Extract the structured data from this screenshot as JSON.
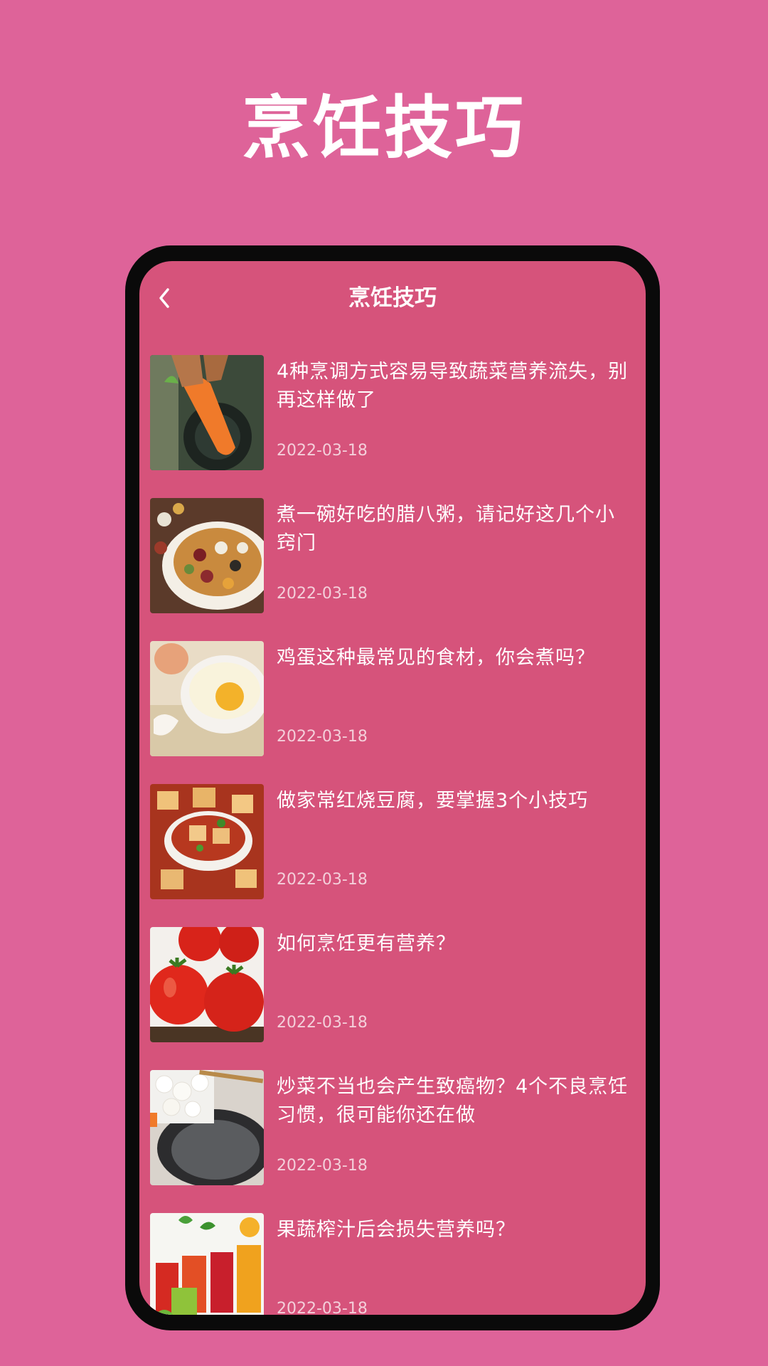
{
  "promo": {
    "title": "烹饪技巧"
  },
  "nav": {
    "back_icon": "chevron-left-icon",
    "title": "烹饪技巧"
  },
  "articles": [
    {
      "title": "4种烹调方式容易导致蔬菜营养流失，别再这样做了",
      "date": "2022-03-18",
      "image": "carrot-photo"
    },
    {
      "title": "煮一碗好吃的腊八粥，请记好这几个小窍门",
      "date": "2022-03-18",
      "image": "beans-bowl-photo"
    },
    {
      "title": "鸡蛋这种最常见的食材，你会煮吗？",
      "date": "2022-03-18",
      "image": "egg-bowl-photo"
    },
    {
      "title": "做家常红烧豆腐，要掌握3个小技巧",
      "date": "2022-03-18",
      "image": "braised-tofu-photo"
    },
    {
      "title": "如何烹饪更有营养？",
      "date": "2022-03-18",
      "image": "tomatoes-photo"
    },
    {
      "title": "炒菜不当也会产生致癌物？4个不良烹饪习惯，很可能你还在做",
      "date": "2022-03-18",
      "image": "onion-pan-photo"
    },
    {
      "title": "果蔬榨汁后会损失营养吗？",
      "date": "2022-03-18",
      "image": "juice-glasses-photo"
    }
  ],
  "colors": {
    "background": "#de6399",
    "screen": "#d6537b",
    "frame": "#0a0a0a",
    "text": "#ffffff"
  }
}
